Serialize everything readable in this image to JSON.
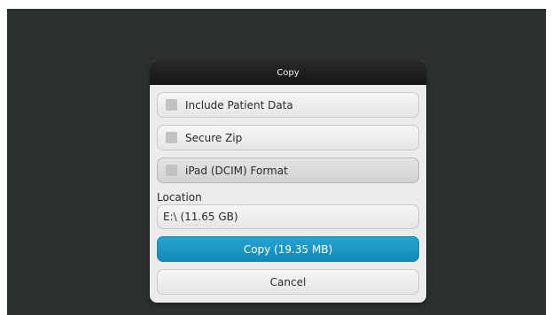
{
  "dialog": {
    "title": "Copy",
    "options": [
      {
        "label": "Include Patient Data"
      },
      {
        "label": "Secure Zip"
      },
      {
        "label": "iPad (DCIM) Format"
      }
    ],
    "location_label": "Location",
    "location_value": "E:\\ (11.65 GB)",
    "copy_label": "Copy (19.35 MB)",
    "cancel_label": "Cancel"
  },
  "colors": {
    "screen_background": "#2c302f",
    "dialog_background": "#ececec",
    "title_bar": "#1c1c1c",
    "accent": "#1a95c4"
  }
}
